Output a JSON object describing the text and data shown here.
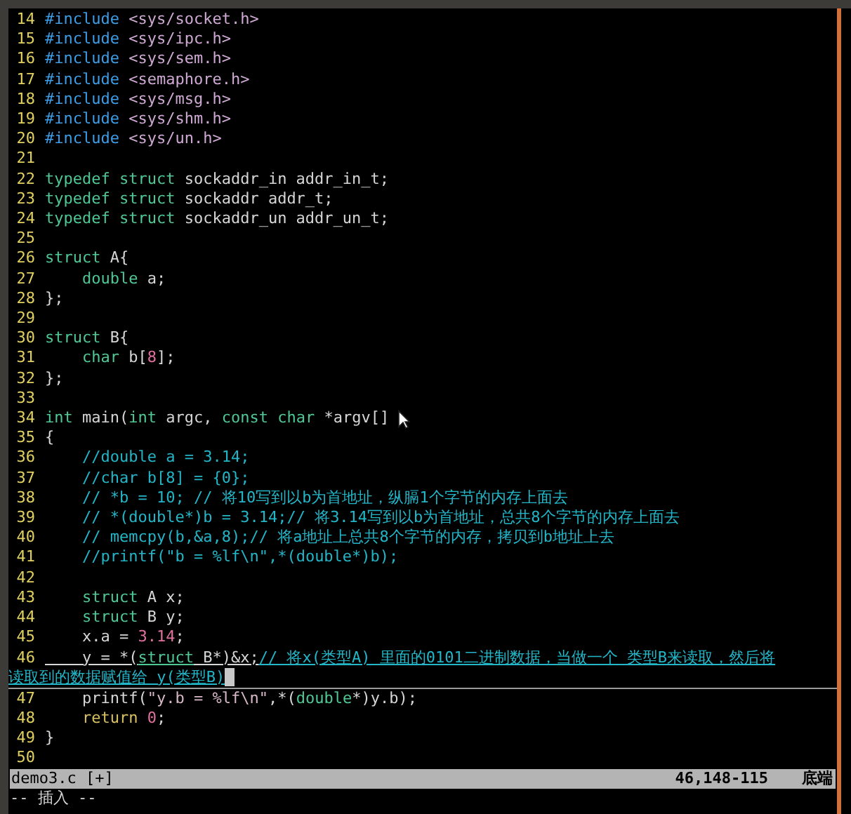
{
  "editor": {
    "lines": [
      {
        "number": "14",
        "current": false,
        "rows": [
          [
            {
              "kind": "pre",
              "text": "#include"
            },
            {
              "kind": "plain",
              "text": " "
            },
            {
              "kind": "header",
              "text": "<sys/socket.h>"
            }
          ]
        ]
      },
      {
        "number": "15",
        "current": false,
        "rows": [
          [
            {
              "kind": "pre",
              "text": "#include"
            },
            {
              "kind": "plain",
              "text": " "
            },
            {
              "kind": "header",
              "text": "<sys/ipc.h>"
            }
          ]
        ]
      },
      {
        "number": "16",
        "current": false,
        "rows": [
          [
            {
              "kind": "pre",
              "text": "#include"
            },
            {
              "kind": "plain",
              "text": " "
            },
            {
              "kind": "header",
              "text": "<sys/sem.h>"
            }
          ]
        ]
      },
      {
        "number": "17",
        "current": false,
        "rows": [
          [
            {
              "kind": "pre",
              "text": "#include"
            },
            {
              "kind": "plain",
              "text": " "
            },
            {
              "kind": "header",
              "text": "<semaphore.h>"
            }
          ]
        ]
      },
      {
        "number": "18",
        "current": false,
        "rows": [
          [
            {
              "kind": "pre",
              "text": "#include"
            },
            {
              "kind": "plain",
              "text": " "
            },
            {
              "kind": "header",
              "text": "<sys/msg.h>"
            }
          ]
        ]
      },
      {
        "number": "19",
        "current": false,
        "rows": [
          [
            {
              "kind": "pre",
              "text": "#include"
            },
            {
              "kind": "plain",
              "text": " "
            },
            {
              "kind": "header",
              "text": "<sys/shm.h>"
            }
          ]
        ]
      },
      {
        "number": "20",
        "current": false,
        "rows": [
          [
            {
              "kind": "pre",
              "text": "#include"
            },
            {
              "kind": "plain",
              "text": " "
            },
            {
              "kind": "header",
              "text": "<sys/un.h>"
            }
          ]
        ]
      },
      {
        "number": "21",
        "current": false
      },
      {
        "number": "22",
        "current": false,
        "rows": [
          [
            {
              "kind": "type",
              "text": "typedef struct"
            },
            {
              "kind": "plain",
              "text": " sockaddr_in addr_in_t;"
            }
          ]
        ]
      },
      {
        "number": "23",
        "current": false,
        "rows": [
          [
            {
              "kind": "type",
              "text": "typedef struct"
            },
            {
              "kind": "plain",
              "text": " sockaddr addr_t;"
            }
          ]
        ]
      },
      {
        "number": "24",
        "current": false,
        "rows": [
          [
            {
              "kind": "type",
              "text": "typedef struct"
            },
            {
              "kind": "plain",
              "text": " sockaddr_un addr_un_t;"
            }
          ]
        ]
      },
      {
        "number": "25",
        "current": false
      },
      {
        "number": "26",
        "current": false,
        "rows": [
          [
            {
              "kind": "type",
              "text": "struct"
            },
            {
              "kind": "plain",
              "text": " A{"
            }
          ]
        ]
      },
      {
        "number": "27",
        "current": false,
        "rows": [
          [
            {
              "kind": "plain",
              "text": "    "
            },
            {
              "kind": "type",
              "text": "double"
            },
            {
              "kind": "plain",
              "text": " a;"
            }
          ]
        ]
      },
      {
        "number": "28",
        "current": false,
        "rows": [
          [
            {
              "kind": "plain",
              "text": "};"
            }
          ]
        ]
      },
      {
        "number": "29",
        "current": false
      },
      {
        "number": "30",
        "current": false,
        "rows": [
          [
            {
              "kind": "type",
              "text": "struct"
            },
            {
              "kind": "plain",
              "text": " B{"
            }
          ]
        ]
      },
      {
        "number": "31",
        "current": false,
        "rows": [
          [
            {
              "kind": "plain",
              "text": "    "
            },
            {
              "kind": "type",
              "text": "char"
            },
            {
              "kind": "plain",
              "text": " b["
            },
            {
              "kind": "number",
              "text": "8"
            },
            {
              "kind": "plain",
              "text": "];"
            }
          ]
        ]
      },
      {
        "number": "32",
        "current": false,
        "rows": [
          [
            {
              "kind": "plain",
              "text": "};"
            }
          ]
        ]
      },
      {
        "number": "33",
        "current": false
      },
      {
        "number": "34",
        "current": false,
        "rows": [
          [
            {
              "kind": "type",
              "text": "int"
            },
            {
              "kind": "plain",
              "text": " main("
            },
            {
              "kind": "type",
              "text": "int"
            },
            {
              "kind": "plain",
              "text": " argc, "
            },
            {
              "kind": "type",
              "text": "const char"
            },
            {
              "kind": "plain",
              "text": " *argv[]"
            }
          ]
        ]
      },
      {
        "number": "35",
        "current": false,
        "rows": [
          [
            {
              "kind": "plain",
              "text": "{"
            }
          ]
        ]
      },
      {
        "number": "36",
        "current": false,
        "rows": [
          [
            {
              "kind": "plain",
              "text": "    "
            },
            {
              "kind": "comment",
              "text": "//double a = 3.14;"
            }
          ]
        ]
      },
      {
        "number": "37",
        "current": false,
        "rows": [
          [
            {
              "kind": "plain",
              "text": "    "
            },
            {
              "kind": "comment",
              "text": "//char b[8] = {0};"
            }
          ]
        ]
      },
      {
        "number": "38",
        "current": false,
        "rows": [
          [
            {
              "kind": "plain",
              "text": "    "
            },
            {
              "kind": "comment",
              "text": "// *b = 10; // 将10写到以b为首地址，纵膈1个字节的内存上面去"
            }
          ]
        ]
      },
      {
        "number": "39",
        "current": false,
        "rows": [
          [
            {
              "kind": "plain",
              "text": "    "
            },
            {
              "kind": "comment",
              "text": "// *(double*)b = 3.14;// 将3.14写到以b为首地址，总共8个字节的内存上面去"
            }
          ]
        ]
      },
      {
        "number": "40",
        "current": false,
        "rows": [
          [
            {
              "kind": "plain",
              "text": "    "
            },
            {
              "kind": "comment",
              "text": "// memcpy(b,&a,8);// 将a地址上总共8个字节的内存，拷贝到b地址上去"
            }
          ]
        ]
      },
      {
        "number": "41",
        "current": false,
        "rows": [
          [
            {
              "kind": "plain",
              "text": "    "
            },
            {
              "kind": "comment",
              "text": "//printf(\"b = %lf\\n\",*(double*)b);"
            }
          ]
        ]
      },
      {
        "number": "42",
        "current": false
      },
      {
        "number": "43",
        "current": false,
        "rows": [
          [
            {
              "kind": "plain",
              "text": "    "
            },
            {
              "kind": "type",
              "text": "struct"
            },
            {
              "kind": "plain",
              "text": " A x;"
            }
          ]
        ]
      },
      {
        "number": "44",
        "current": false,
        "rows": [
          [
            {
              "kind": "plain",
              "text": "    "
            },
            {
              "kind": "type",
              "text": "struct"
            },
            {
              "kind": "plain",
              "text": " B y;"
            }
          ]
        ]
      },
      {
        "number": "45",
        "current": false,
        "rows": [
          [
            {
              "kind": "plain",
              "text": "    x.a = "
            },
            {
              "kind": "number",
              "text": "3.14"
            },
            {
              "kind": "plain",
              "text": ";"
            }
          ]
        ]
      },
      {
        "number": "46",
        "current": true,
        "rows": [
          [
            {
              "kind": "plain",
              "text": "    y = *("
            },
            {
              "kind": "type",
              "text": "struct"
            },
            {
              "kind": "plain",
              "text": " B*)&x;"
            },
            {
              "kind": "comment",
              "text": "// 将x(类型A) 里面的0101二进制数据，当做一个 类型B来读取，然后将"
            }
          ],
          [
            {
              "kind": "comment",
              "text": "读取到的数据赋值给 y(类型B)"
            }
          ]
        ]
      },
      {
        "number": "47",
        "current": false,
        "rows": [
          [
            {
              "kind": "plain",
              "text": "    printf("
            },
            {
              "kind": "string",
              "text": "\"y.b = %lf\\n\""
            },
            {
              "kind": "plain",
              "text": ",*("
            },
            {
              "kind": "type",
              "text": "double"
            },
            {
              "kind": "plain",
              "text": "*)y.b);"
            }
          ]
        ]
      },
      {
        "number": "48",
        "current": false,
        "rows": [
          [
            {
              "kind": "plain",
              "text": "    "
            },
            {
              "kind": "keyword",
              "text": "return"
            },
            {
              "kind": "plain",
              "text": " "
            },
            {
              "kind": "number",
              "text": "0"
            },
            {
              "kind": "plain",
              "text": ";"
            }
          ]
        ]
      },
      {
        "number": "49",
        "current": false,
        "rows": [
          [
            {
              "kind": "plain",
              "text": "}"
            }
          ]
        ]
      },
      {
        "number": "50",
        "current": false
      }
    ]
  },
  "status_bar": {
    "file": "demo3.c [+]",
    "position": "46,148-115",
    "scroll": "底端"
  },
  "mode_line": "-- 插入 --"
}
